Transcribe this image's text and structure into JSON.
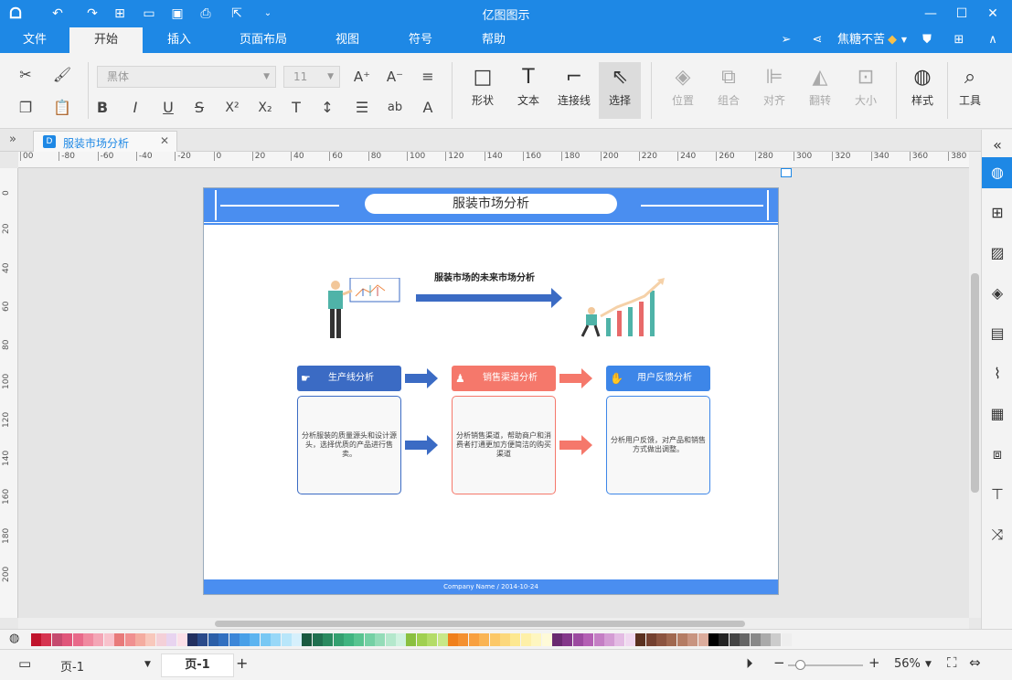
{
  "app": {
    "title": "亿图图示"
  },
  "window_controls": {
    "minimize": "—",
    "maximize": "☐",
    "close": "✕"
  },
  "menu": {
    "tabs": [
      {
        "label": "文件"
      },
      {
        "label": "开始"
      },
      {
        "label": "插入"
      },
      {
        "label": "页面布局"
      },
      {
        "label": "视图"
      },
      {
        "label": "符号"
      },
      {
        "label": "帮助"
      }
    ],
    "user_name": "焦糖不苦"
  },
  "ribbon": {
    "font_family": "黑体",
    "font_size": "11",
    "tools": [
      {
        "label": "形状"
      },
      {
        "label": "文本"
      },
      {
        "label": "连接线"
      },
      {
        "label": "选择"
      }
    ],
    "arrange": [
      {
        "label": "位置"
      },
      {
        "label": "组合"
      },
      {
        "label": "对齐"
      },
      {
        "label": "翻转"
      },
      {
        "label": "大小"
      }
    ],
    "style_label": "样式",
    "tools_label": "工具"
  },
  "document": {
    "tab_label": "服装市场分析"
  },
  "rulers": {
    "h_ticks": [
      "00",
      "-80",
      "-60",
      "-40",
      "-20",
      "0",
      "20",
      "40",
      "60",
      "80",
      "100",
      "120",
      "140",
      "160",
      "180",
      "200",
      "220",
      "240",
      "260",
      "280",
      "300",
      "320",
      "340",
      "360",
      "380"
    ],
    "v_ticks": [
      "0",
      "20",
      "40",
      "60",
      "80",
      "100",
      "120",
      "140",
      "160",
      "180",
      "200"
    ]
  },
  "diagram": {
    "header_title": "服装市场分析",
    "subtitle": "服装市场的未来市场分析",
    "cards": [
      {
        "title": "生产线分析",
        "body": "分析服装的质量源头和设计源头，选择优质的产品进行售卖。",
        "color": "#3b6bc4"
      },
      {
        "title": "销售渠道分析",
        "body": "分析销售渠道，帮助商户和消费者打通更加方便简洁的购买渠道",
        "color": "#f5786b"
      },
      {
        "title": "用户反馈分析",
        "body": "分析用户反馈，对产品和销售方式做出调整。",
        "color": "#3d86e8"
      }
    ],
    "footer": "Company Name / 2014-10-24"
  },
  "status": {
    "page_selector": "页-1",
    "page_tab": "页-1",
    "add_page": "+",
    "zoom": "56%"
  },
  "colors": {
    "accent": "#1e88e5",
    "header_bar": "#4a8ef0"
  }
}
